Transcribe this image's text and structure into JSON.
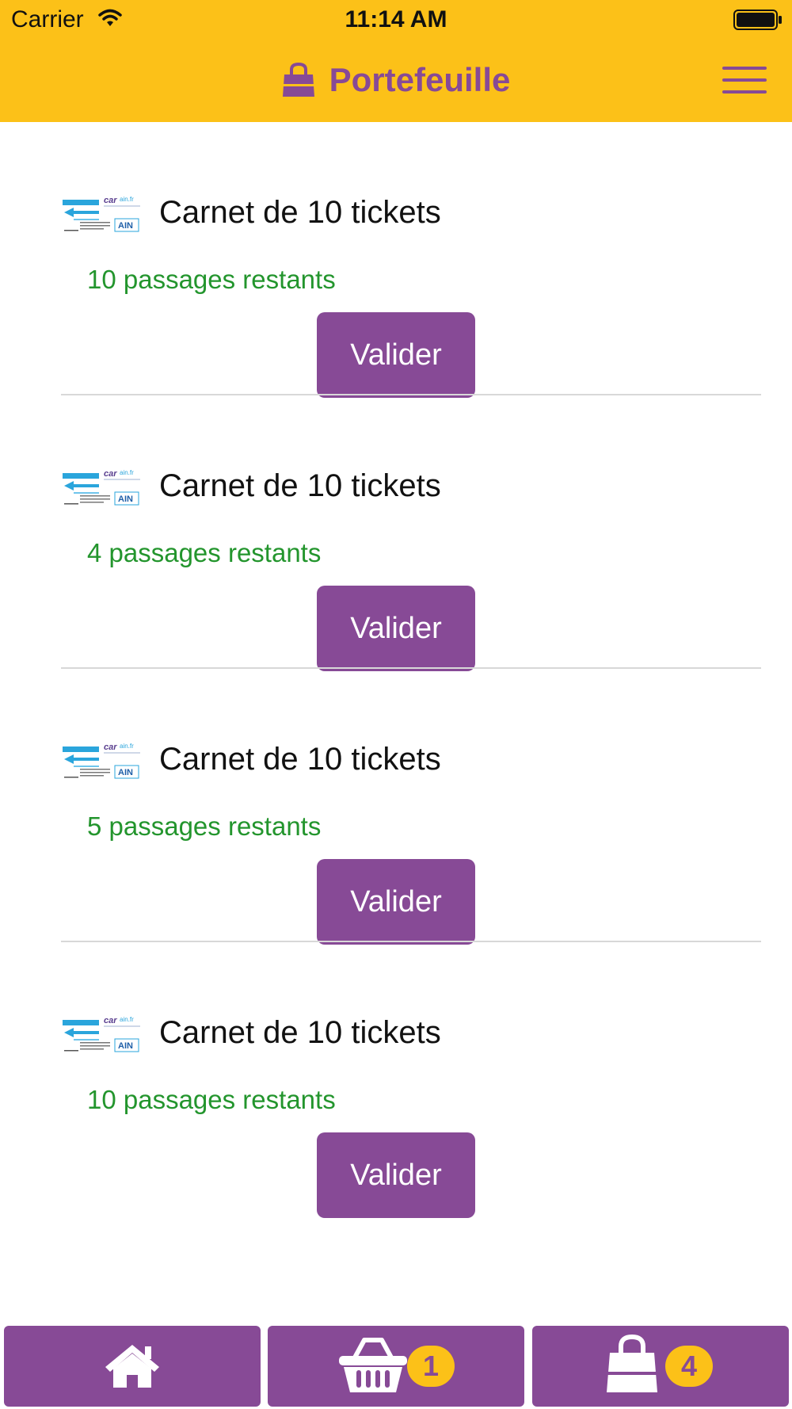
{
  "status_bar": {
    "carrier": "Carrier",
    "time": "11:14 AM"
  },
  "header": {
    "title": "Portefeuille",
    "title_icon": "shopping-bag-icon",
    "menu_icon": "hamburger-menu-icon"
  },
  "tickets": [
    {
      "title": "Carnet de 10 tickets",
      "remaining": "10 passages restants",
      "button": "Valider"
    },
    {
      "title": "Carnet de 10 tickets",
      "remaining": "4 passages restants",
      "button": "Valider"
    },
    {
      "title": "Carnet de 10 tickets",
      "remaining": "5 passages restants",
      "button": "Valider"
    },
    {
      "title": "Carnet de 10 tickets",
      "remaining": "10 passages restants",
      "button": "Valider"
    }
  ],
  "tabbar": {
    "home_icon": "home-icon",
    "cart_icon": "basket-icon",
    "cart_count": "1",
    "wallet_icon": "shopping-bag-icon",
    "wallet_count": "4"
  },
  "colors": {
    "header_bg": "#FCC118",
    "accent": "#874A96",
    "remaining_text": "#23952D"
  }
}
